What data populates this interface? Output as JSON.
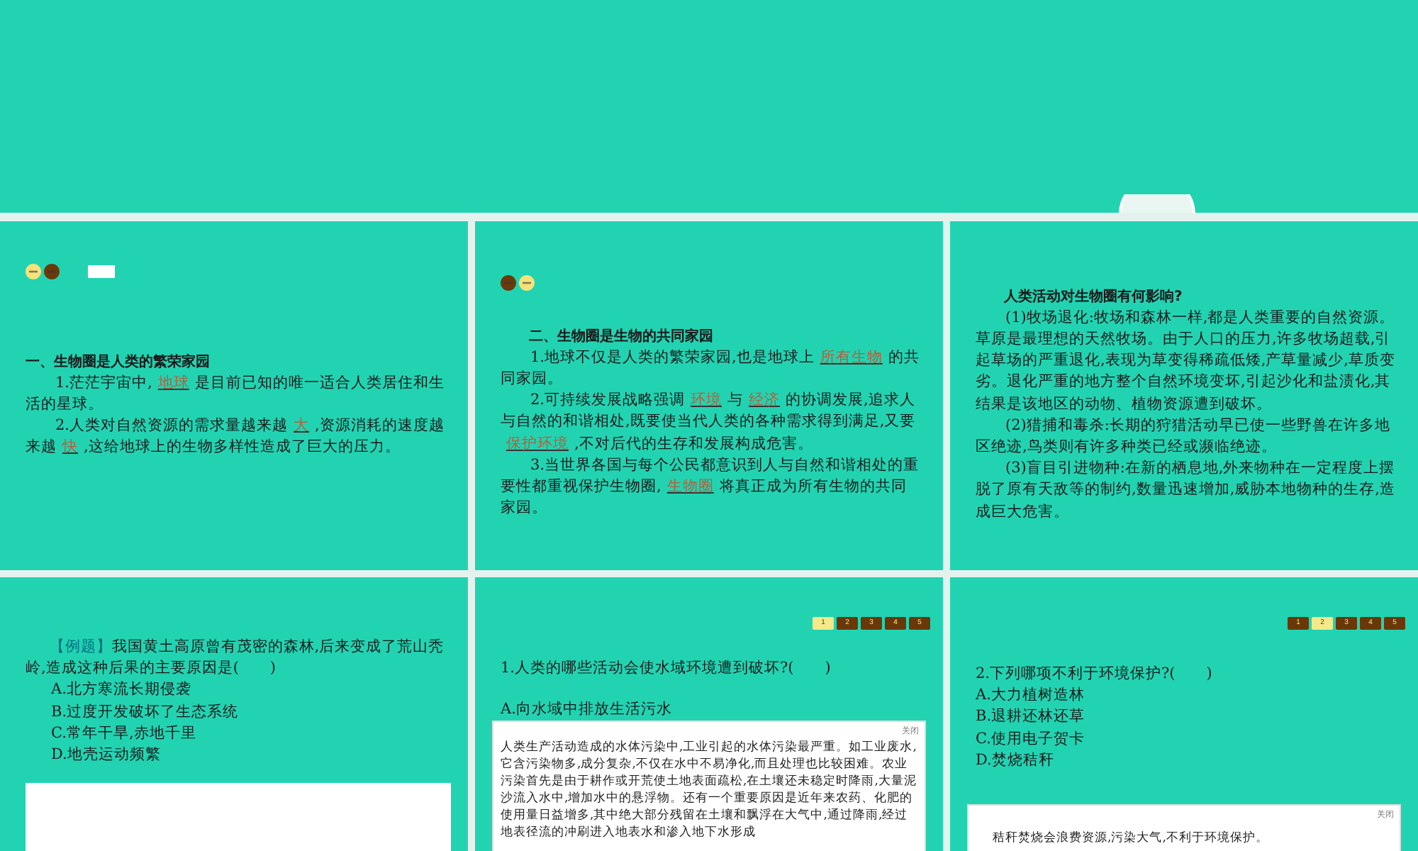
{
  "slides": [
    {
      "kind": "notes",
      "icons": [
        {
          "kind": "circle",
          "color": "#f6e27a"
        },
        {
          "kind": "circle",
          "color": "#6b3a0a"
        },
        {
          "kind": "box",
          "color": "#ffffff"
        }
      ],
      "heading": "一、生物圈是人类的繁荣家园",
      "paragraphs": [
        [
          {
            "text": "1.茫茫宇宙中,"
          },
          {
            "blank": "地球"
          },
          {
            "text": "是目前已知的唯一适合人类居住和生活的星球。"
          }
        ],
        [
          {
            "text": "2.人类对自然资源的需求量越来越"
          },
          {
            "blank": "大"
          },
          {
            "text": ",资源消耗的速度越来越"
          },
          {
            "blank": "快"
          },
          {
            "text": ",这给地球上的生物多样性造成了巨大的压力。"
          }
        ]
      ]
    },
    {
      "kind": "notes",
      "icons": [
        {
          "kind": "circle",
          "color": "#6b3a0a"
        },
        {
          "kind": "circle",
          "color": "#f6e27a"
        }
      ],
      "heading": "二、生物圈是生物的共同家园",
      "paragraphs": [
        [
          {
            "text": "1.地球不仅是人类的繁荣家园,也是地球上"
          },
          {
            "blank": "所有生物"
          },
          {
            "text": "的共同家园。"
          }
        ],
        [
          {
            "text": "2.可持续发展战略强调"
          },
          {
            "blank": "环境"
          },
          {
            "text": "与"
          },
          {
            "blank": "经济"
          },
          {
            "text": "的协调发展,追求人与自然的和谐相处,既要使当代人类的各种需求得到满足,又要"
          },
          {
            "blank": "保护环境"
          },
          {
            "text": ",不对后代的生存和发展构成危害。"
          }
        ],
        [
          {
            "text": "3.当世界各国与每个公民都意识到人与自然和谐相处的重要性都重视保护生物圈,"
          },
          {
            "blank": "生物圈"
          },
          {
            "text": "将真正成为所有生物的共同家园。"
          }
        ]
      ]
    },
    {
      "kind": "notes",
      "heading": "人类活动对生物圈有何影响?",
      "paragraphs": [
        [
          {
            "text": "(1)牧场退化:牧场和森林一样,都是人类重要的自然资源。草原是最理想的天然牧场。由于人口的压力,许多牧场超载,引起草场的严重退化,表现为草变得稀疏低矮,产草量减少,草质变劣。退化严重的地方整个自然环境变坏,引起沙化和盐渍化,其结果是该地区的动物、植物资源遭到破坏。"
          }
        ],
        [
          {
            "text": "(2)猎捕和毒杀:长期的狩猎活动早已使一些野兽在许多地区绝迹,鸟类则有许多种类已经或濒临绝迹。"
          }
        ],
        [
          {
            "text": "(3)盲目引进物种:在新的栖息地,外来物种在一定程度上摆脱了原有天敌等的制约,数量迅速增加,威胁本地物种的生存,造成巨大危害。"
          }
        ]
      ]
    },
    {
      "kind": "question",
      "tag": "【例题】",
      "question": "我国黄土高原曾有茂密的森林,后来变成了荒山秃岭,造成这种后果的主要原因是(　　)",
      "options": [
        "A.北方寒流长期侵袭",
        "B.过度开发破坏了生态系统",
        "C.常年干旱,赤地千里",
        "D.地壳运动频繁"
      ],
      "answer_panel": true
    },
    {
      "kind": "question",
      "pager": [
        {
          "label": "1",
          "selected": true
        },
        {
          "label": "2",
          "selected": false
        },
        {
          "label": "3",
          "selected": false
        },
        {
          "label": "4",
          "selected": false
        },
        {
          "label": "5",
          "selected": false
        }
      ],
      "question": "1.人类的哪些活动会使水域环境遭到破坏?(　　)",
      "options": [
        "A.向水域中排放生活污水"
      ],
      "popup": {
        "close": "关闭",
        "text": "人类生产活动造成的水体污染中,工业引起的水体污染最严重。如工业废水,它含污染物多,成分复杂,不仅在水中不易净化,而且处理也比较困难。农业污染首先是由于耕作或开荒使土地表面疏松,在土壤还未稳定时降雨,大量泥沙流入水中,增加水中的悬浮物。还有一个重要原因是近年来农药、化肥的使用量日益增多,其中绝大部分残留在土壤和飘浮在大气中,通过降雨,经过地表径流的冲刷进入地表水和渗入地下水形成"
      }
    },
    {
      "kind": "question",
      "pager": [
        {
          "label": "1",
          "selected": false
        },
        {
          "label": "2",
          "selected": true
        },
        {
          "label": "3",
          "selected": false
        },
        {
          "label": "4",
          "selected": false
        },
        {
          "label": "5",
          "selected": false
        }
      ],
      "question": "2.下列哪项不利于环境保护?(　　)",
      "options": [
        "A.大力植树造林",
        "B.退耕还林还草",
        "C.使用电子贺卡",
        "D.焚烧秸秆"
      ],
      "popup": {
        "close": "关闭",
        "text": "秸秆焚烧会浪费资源,污染大气,不利于环境保护。"
      }
    }
  ]
}
